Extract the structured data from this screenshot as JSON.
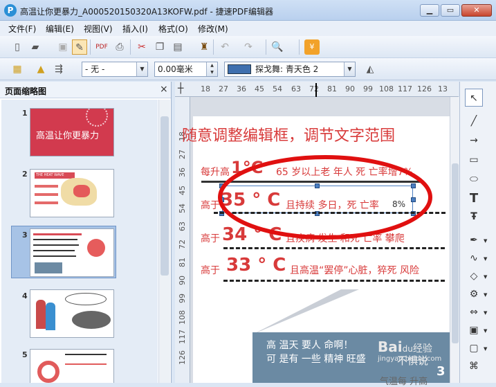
{
  "window": {
    "title": "高温让你更暴力_A000520150320A13KOFW.pdf - 捷速PDF编辑器",
    "app_icon": "P",
    "min_label": "▁",
    "max_label": "▭",
    "close_label": "✕"
  },
  "menu": [
    "文件(F)",
    "编辑(E)",
    "视图(V)",
    "插入(I)",
    "格式(O)",
    "修改(M)"
  ],
  "toolbar2": {
    "fill_select": "- 无 -",
    "width_input": "0.00毫米",
    "color_name": "探戈舞: 青天色 2",
    "color_swatch": "#3f6fae"
  },
  "sidebar": {
    "title": "页面缩略图",
    "close": "×",
    "thumbs": [
      {
        "num": "1",
        "caption": "高温让你更暴力",
        "bg": "#d23a4e"
      },
      {
        "num": "2",
        "banner": "THE HEAT WAVE"
      },
      {
        "num": "3"
      },
      {
        "num": "4"
      },
      {
        "num": "5"
      }
    ]
  },
  "ruler": {
    "top": [
      "18",
      "27",
      "36",
      "45",
      "54",
      "63",
      "72",
      "81",
      "90",
      "99",
      "108",
      "117",
      "126",
      "13"
    ],
    "left": [
      "18",
      "27",
      "36",
      "45",
      "54",
      "63",
      "72",
      "81",
      "90",
      "99",
      "108",
      "117",
      "126"
    ]
  },
  "doc": {
    "heading": "随意调整编辑框，调节文字范围",
    "line1_pre": "每升高",
    "line1_big": "1°C",
    "line1_rest": "65 岁以上老 年人 死 亡率增7%",
    "line2_pre": "高于",
    "line2_big": "35 ° C",
    "line2_rest": "且持续 多日，死 亡率",
    "line2_pct": "8%",
    "line3_pre": "高于",
    "line3_big": "34 ° C",
    "line3_rest": "且疾病 发生 和死 亡率 攀爬",
    "line4_pre": "高于",
    "line4_big": "33 ° C",
    "line4_rest": "且高温“罢停”心脏，猝死 风险",
    "bubble_line1": "高 温天 要人 命啊！",
    "bubble_line2": "可 是有 一些 精神 旺盛",
    "bubble_trail": "3",
    "bottom_text": "气温每 升高",
    "accent": "#d83a3a",
    "ellipse": "#e01010"
  },
  "watermark": {
    "brand": "Bai",
    "paw": "du",
    "brand2": "经验",
    "url": "jingyan.baidu.com",
    "overlay": "不惧说"
  }
}
